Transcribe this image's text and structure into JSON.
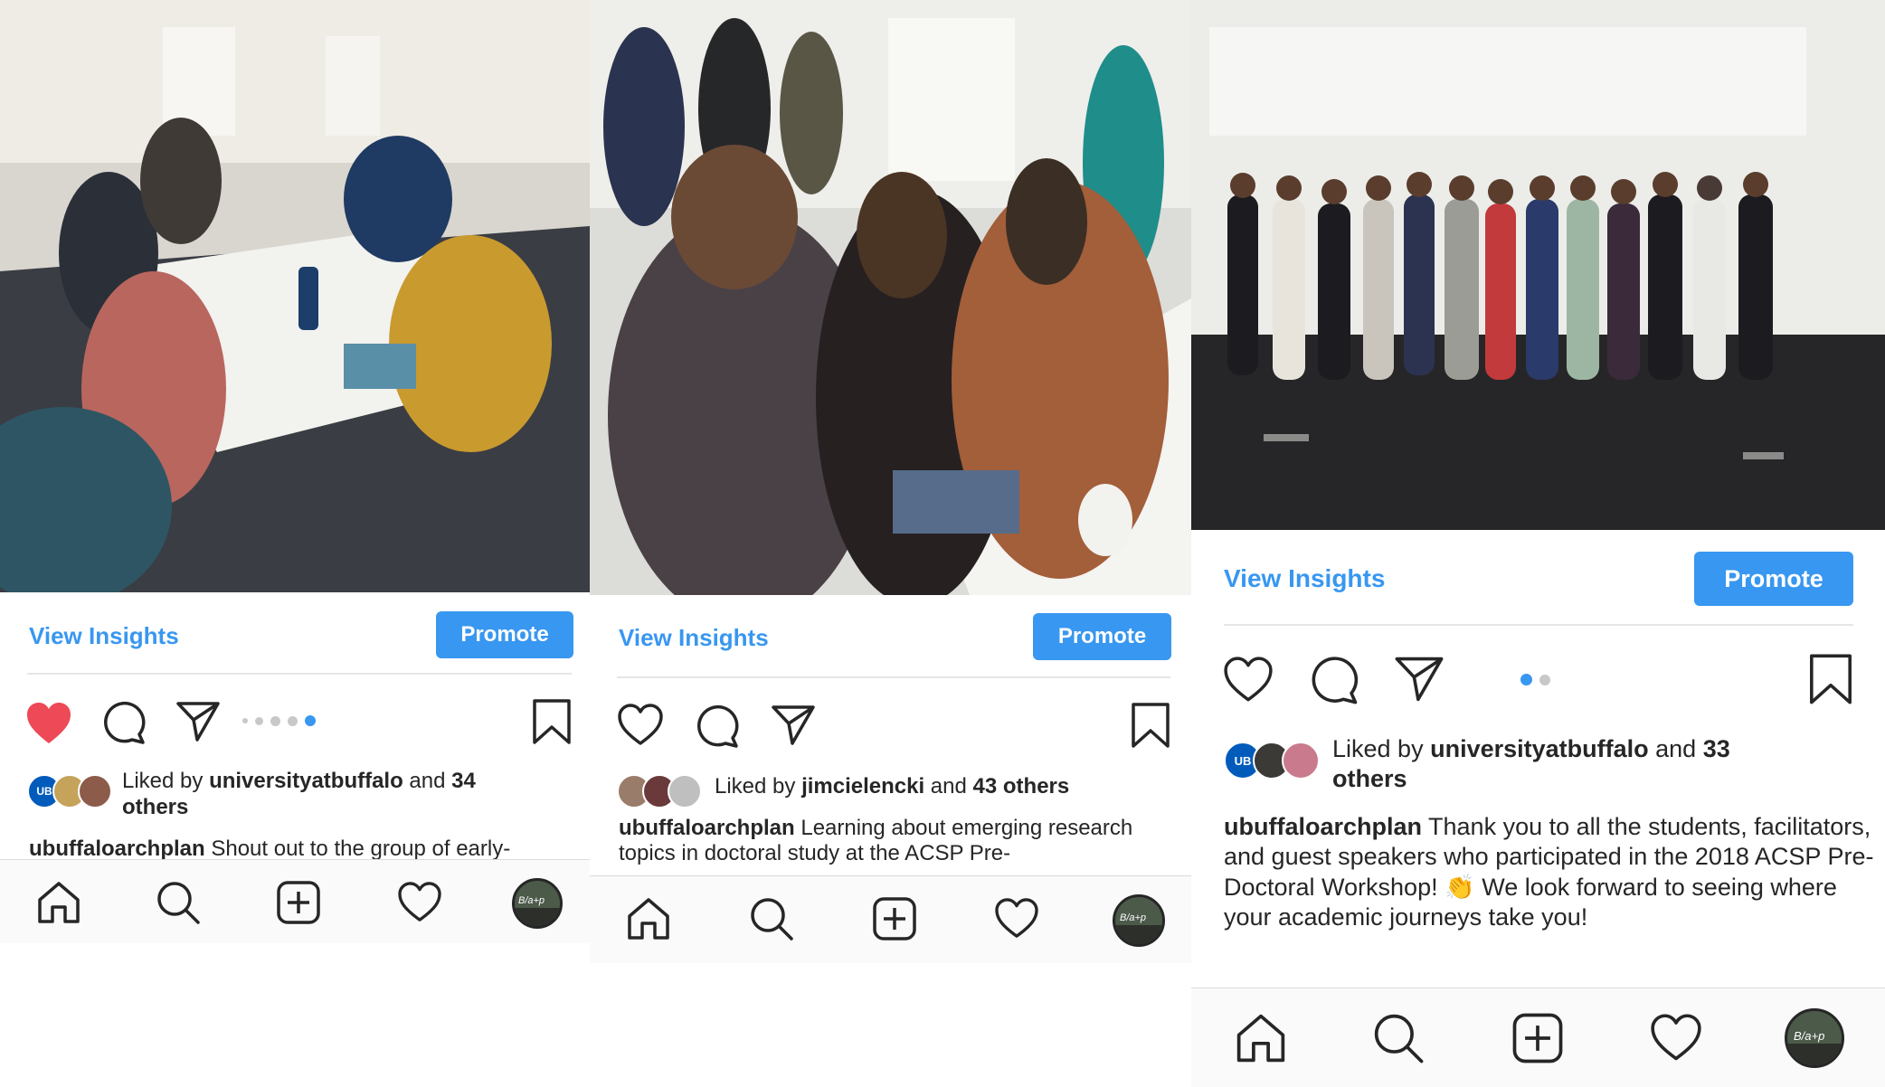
{
  "panels": [
    {
      "view_insights": "View Insights",
      "promote": "Promote",
      "liked_prefix": "Liked by ",
      "liked_user": "universityatbuffalo",
      "liked_mid": " and ",
      "liked_count": "34",
      "liked_suffix": "others",
      "caption_user": "ubuffaloarchplan",
      "caption_text": " Shout out to the group of early-",
      "liked_state": "liked",
      "carousel_active": 4,
      "carousel_total": 5
    },
    {
      "view_insights": "View Insights",
      "promote": "Promote",
      "liked_prefix": "Liked by ",
      "liked_user": "jimcielencki",
      "liked_mid": " and ",
      "liked_count": "43 others",
      "caption_user": "ubuffaloarchplan",
      "caption_text": " Learning about emerging research topics in doctoral study at the ACSP Pre-",
      "liked_state": "not-liked"
    },
    {
      "view_insights": "View Insights",
      "promote": "Promote",
      "liked_prefix": "Liked by ",
      "liked_user": "universityatbuffalo",
      "liked_mid": " and ",
      "liked_count": "33",
      "liked_suffix": "others",
      "caption_user": "ubuffaloarchplan",
      "caption_text": " Thank you to all the students, facilitators, and guest speakers who participated in the 2018 ACSP Pre-Doctoral Workshop! 👏 We look forward to seeing where your academic journeys take you!",
      "liked_state": "not-liked",
      "carousel_active": 1,
      "carousel_total": 2
    }
  ],
  "avatar_badge": "UB",
  "profile_badge": "B/a+p",
  "colors": {
    "accent": "#3897f0",
    "like_red": "#ed4956",
    "text": "#262626",
    "ub_blue": "#005bbb"
  },
  "icons": [
    "heart-icon",
    "comment-icon",
    "share-icon",
    "bookmark-icon",
    "home-icon",
    "search-icon",
    "add-post-icon",
    "activity-heart-icon",
    "profile-icon"
  ]
}
